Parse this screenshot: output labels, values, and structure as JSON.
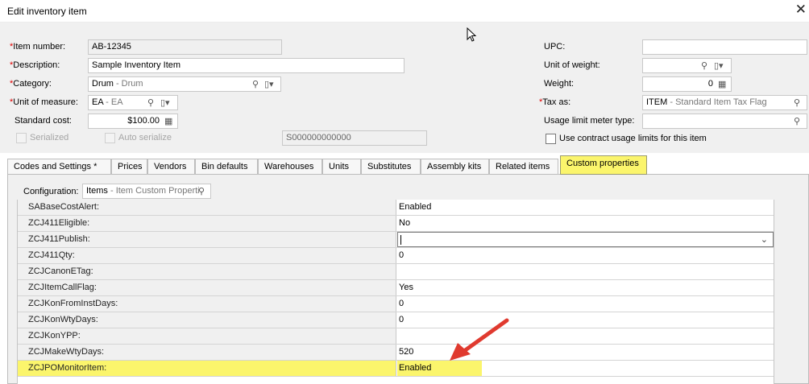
{
  "window": {
    "title": "Edit inventory item"
  },
  "colors": {
    "highlight": "#fbf56c",
    "required": "#dd0000",
    "arrow": "#e03a2f"
  },
  "fields": {
    "item_number": {
      "label": "Item number:",
      "value": "AB-12345"
    },
    "description": {
      "label": "Description:",
      "value": "Sample Inventory Item"
    },
    "category": {
      "label": "Category:",
      "code": "Drum",
      "desc": "Drum"
    },
    "unit_of_measure": {
      "label": "Unit of measure:",
      "code": "EA",
      "desc": "EA"
    },
    "standard_cost": {
      "label": "Standard cost:",
      "value": "$100.00"
    },
    "serialized": {
      "label": "Serialized"
    },
    "auto_serialize": {
      "label": "Auto serialize"
    },
    "serial_mask": {
      "value": "S000000000000"
    },
    "upc": {
      "label": "UPC:",
      "value": ""
    },
    "unit_of_weight": {
      "label": "Unit of weight:",
      "value": ""
    },
    "weight": {
      "label": "Weight:",
      "value": "0"
    },
    "tax_as": {
      "label": "Tax as:",
      "code": "ITEM",
      "desc": "Standard Item Tax Flag"
    },
    "usage_limit_meter_type": {
      "label": "Usage limit meter type:",
      "value": ""
    },
    "use_contract_usage_limits": {
      "label": "Use contract usage limits for this item"
    }
  },
  "required_mark": "*",
  "code_sep": " - ",
  "tabs": [
    {
      "label": "Codes and Settings  *"
    },
    {
      "label": "Prices"
    },
    {
      "label": "Vendors"
    },
    {
      "label": "Bin defaults"
    },
    {
      "label": "Warehouses"
    },
    {
      "label": "Units"
    },
    {
      "label": "Substitutes"
    },
    {
      "label": "Assembly kits"
    },
    {
      "label": "Related items"
    },
    {
      "label": "Custom properties"
    }
  ],
  "configuration": {
    "label": "Configuration:",
    "code": "Items",
    "desc": "Item Custom Properti"
  },
  "properties": [
    {
      "name": "SABaseCostAlert:",
      "value": "Enabled"
    },
    {
      "name": "ZCJ411Eligible:",
      "value": "No"
    },
    {
      "name": "ZCJ411Publish:",
      "value": ""
    },
    {
      "name": "ZCJ411Qty:",
      "value": "0"
    },
    {
      "name": "ZCJCanonETag:",
      "value": ""
    },
    {
      "name": "ZCJItemCallFlag:",
      "value": "Yes"
    },
    {
      "name": "ZCJKonFromInstDays:",
      "value": "0"
    },
    {
      "name": "ZCJKonWtyDays:",
      "value": "0"
    },
    {
      "name": "ZCJKonYPP:",
      "value": ""
    },
    {
      "name": "ZCJMakeWtyDays:",
      "value": "520"
    },
    {
      "name": "ZCJPOMonitorItem:",
      "value": "Enabled"
    }
  ]
}
